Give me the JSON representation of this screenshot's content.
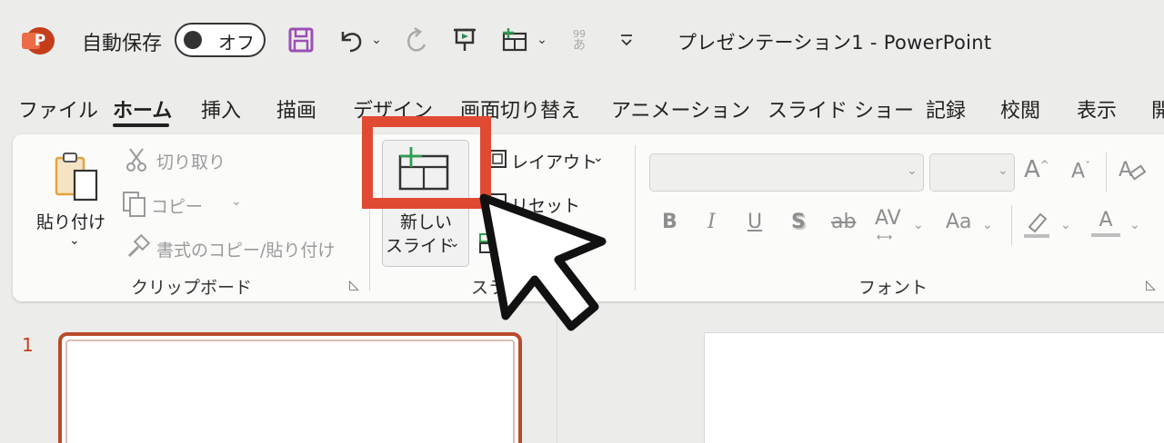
{
  "titlebar": {
    "app_logo_letter": "P",
    "autosave_label": "自動保存",
    "autosave_state": "オフ",
    "quick_access_icons": [
      "save-icon",
      "undo-icon",
      "undo-dropdown-icon",
      "redo-icon",
      "present-from-start-icon",
      "new-slide-qa-icon",
      "qa-dropdown-icon",
      "spelling-icon",
      "customize-qa-icon"
    ],
    "spell_top": "99",
    "spell_bottom": "あ",
    "document_title": "プレゼンテーション1  -  PowerPoint"
  },
  "ribbon_tabs": [
    {
      "label": "ファイル"
    },
    {
      "label": "ホーム",
      "active": true
    },
    {
      "label": "挿入"
    },
    {
      "label": "描画"
    },
    {
      "label": "デザイン"
    },
    {
      "label": "画面切り替え"
    },
    {
      "label": "アニメーション"
    },
    {
      "label": "スライド ショー"
    },
    {
      "label": "記録"
    },
    {
      "label": "校閲"
    },
    {
      "label": "表示"
    },
    {
      "label": "開"
    }
  ],
  "clipboard": {
    "paste_line1": "貼り付け",
    "cut": "切り取り",
    "copy": "コピー",
    "format_painter": "書式のコピー/貼り付け",
    "group_label": "クリップボード"
  },
  "slides": {
    "new_slide_line1": "新しい",
    "new_slide_line2": "スライド",
    "layout": "レイアウト",
    "reset": "リセット",
    "group_label": "スライ"
  },
  "font": {
    "font_name": "",
    "font_size": "",
    "grow": "A",
    "shrink": "A",
    "bold": "B",
    "italic": "I",
    "underline": "U",
    "shadow": "S",
    "strike": "ab",
    "spacing": "AV",
    "case": "Aa",
    "font_color": "A",
    "group_label": "フォント"
  },
  "slide_panel": {
    "slide_number": "1"
  },
  "colors": {
    "accent": "#c43e1c",
    "highlight": "#e04a32",
    "autosave_icon": "#9b4fb6"
  }
}
